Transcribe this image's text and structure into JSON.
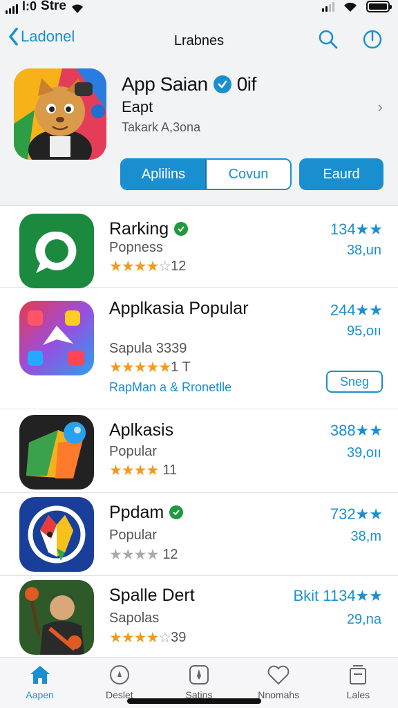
{
  "status": {
    "carrier": "Stre"
  },
  "nav": {
    "back_label": "Ladonel",
    "title": "Lrabnes"
  },
  "featured": {
    "title": "App Saian",
    "badge_text": "0if",
    "subtitle": "Eapt",
    "meta": "Takark A,3ona"
  },
  "segments": [
    {
      "label": "Aplilins",
      "selected": true
    },
    {
      "label": "Covun",
      "selected": false
    }
  ],
  "primary_button": "Eaurd",
  "apps": [
    {
      "name": "Rarking",
      "verified": true,
      "category": "Popness",
      "rating": 4,
      "rating_text": "12",
      "score": "134★★",
      "size": "38,un"
    },
    {
      "name": "Applkasia Popular",
      "verified": false,
      "category": "Sapula 3339",
      "rating": 5,
      "rating_text": "1 T",
      "score": "244★★",
      "size": "95,oıı",
      "link": "RapMan a & Rronetlle",
      "action": "Sneg"
    },
    {
      "name": "Aplkasis",
      "verified": false,
      "category": "Popular",
      "rating": 4,
      "rating_text": "11",
      "score": "388★★",
      "size": "39,oıı"
    },
    {
      "name": "Ppdam",
      "verified": true,
      "category": "Popular",
      "rating": 4,
      "rating_text": "12",
      "score": "732★★",
      "size": "38,m"
    },
    {
      "name": "Spalle Dert",
      "verified": false,
      "category": "Sapolas",
      "rating": 4,
      "rating_text": "39",
      "score": "Bkit 1134★★",
      "size": "29,na"
    }
  ],
  "tabs": [
    {
      "label": "Aapen",
      "active": true
    },
    {
      "label": "Deslet",
      "active": false
    },
    {
      "label": "Satins",
      "active": false
    },
    {
      "label": "Nnomahs",
      "active": false
    },
    {
      "label": "Lales",
      "active": false
    }
  ],
  "colors": {
    "accent": "#1a8fd0",
    "star": "#f29a1a",
    "verified_green": "#1e9a3c"
  }
}
